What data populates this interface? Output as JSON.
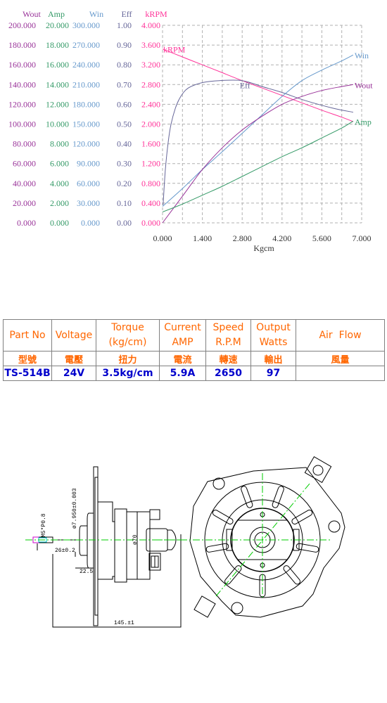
{
  "chart_data": {
    "type": "line",
    "xlabel": "Kgcm",
    "xlim": [
      0,
      7.0
    ],
    "xticks": [
      "0.000",
      "1.400",
      "2.800",
      "4.200",
      "5.600",
      "7.000"
    ],
    "grid": true,
    "gridDivisions": 10,
    "axes": [
      {
        "name": "Wout",
        "color": "#993399",
        "range": [
          0,
          200
        ],
        "ticks": [
          "0.000",
          "20.000",
          "40.000",
          "60.000",
          "80.000",
          "100.000",
          "120.000",
          "140.000",
          "160.000",
          "180.000",
          "200.000"
        ]
      },
      {
        "name": "Amp",
        "color": "#339966",
        "range": [
          0,
          20
        ],
        "ticks": [
          "0.000",
          "2.000",
          "4.000",
          "6.000",
          "8.000",
          "10.000",
          "12.000",
          "14.000",
          "16.000",
          "18.000",
          "20.000"
        ]
      },
      {
        "name": "Win",
        "color": "#6699cc",
        "range": [
          0,
          300
        ],
        "ticks": [
          "0.000",
          "30.000",
          "60.000",
          "90.000",
          "120.000",
          "150.000",
          "180.000",
          "210.000",
          "240.000",
          "270.000",
          "300.000"
        ]
      },
      {
        "name": "Eff",
        "color": "#666699",
        "range": [
          0,
          1.0
        ],
        "ticks": [
          "0.00",
          "0.10",
          "0.20",
          "0.30",
          "0.40",
          "0.50",
          "0.60",
          "0.70",
          "0.80",
          "0.90",
          "1.00"
        ]
      },
      {
        "name": "kRPM",
        "color": "#ff3399",
        "range": [
          0,
          4.0
        ],
        "ticks": [
          "0.000",
          "0.400",
          "0.800",
          "1.200",
          "1.600",
          "2.000",
          "2.400",
          "2.800",
          "3.200",
          "3.600",
          "4.000"
        ]
      }
    ],
    "series": [
      {
        "name": "kRPM",
        "label": "kRPM",
        "axis": "kRPM",
        "color": "#ff3399",
        "labelPos": "start",
        "x": [
          0,
          0.7,
          1.4,
          2.1,
          2.8,
          3.5,
          4.2,
          4.9,
          5.6,
          6.3,
          6.7
        ],
        "y": [
          3.52,
          3.36,
          3.2,
          3.04,
          2.88,
          2.73,
          2.58,
          2.43,
          2.28,
          2.14,
          2.05
        ]
      },
      {
        "name": "Eff",
        "label": "Eff",
        "axis": "Eff",
        "color": "#666699",
        "labelPos": "mid",
        "x": [
          0.02,
          0.1,
          0.2,
          0.3,
          0.45,
          0.6,
          0.8,
          1.0,
          1.4,
          2.0,
          2.8,
          3.5,
          4.2,
          5.0,
          6.0,
          6.7
        ],
        "y": [
          0.09,
          0.27,
          0.41,
          0.5,
          0.58,
          0.63,
          0.67,
          0.69,
          0.71,
          0.72,
          0.72,
          0.69,
          0.66,
          0.62,
          0.58,
          0.56
        ]
      },
      {
        "name": "Win",
        "label": "Win",
        "axis": "Win",
        "color": "#6699cc",
        "labelPos": "end",
        "x": [
          0,
          0.7,
          1.4,
          2.1,
          2.8,
          3.5,
          4.2,
          4.9,
          5.6,
          6.3,
          6.7
        ],
        "y": [
          25,
          52,
          81,
          108,
          136,
          164,
          192,
          216,
          232,
          246,
          255
        ]
      },
      {
        "name": "Wout",
        "label": "Wout",
        "axis": "Wout",
        "color": "#993399",
        "labelPos": "end",
        "x": [
          0,
          0.7,
          1.4,
          2.1,
          2.8,
          3.5,
          4.2,
          4.9,
          5.6,
          6.3,
          6.7
        ],
        "y": [
          0,
          27,
          54,
          76,
          94,
          108,
          120,
          128,
          134,
          138,
          140
        ]
      },
      {
        "name": "Amp",
        "label": "Amp",
        "axis": "Amp",
        "color": "#339966",
        "labelPos": "end",
        "x": [
          0,
          0.7,
          1.4,
          2.1,
          2.8,
          3.5,
          4.2,
          4.9,
          5.6,
          6.3,
          6.7
        ],
        "y": [
          1.1,
          1.9,
          2.8,
          3.7,
          4.7,
          5.7,
          6.7,
          7.6,
          8.6,
          9.6,
          10.3
        ]
      }
    ]
  },
  "spec_table": {
    "headers": [
      "Part No",
      "Voltage",
      "Torque\n(kg/cm)",
      "Current\nAMP",
      "Speed\nR.P.M",
      "Output\nWatts",
      "Air  Flow"
    ],
    "headers_zh": [
      "型號",
      "電壓",
      "扭力",
      "電流",
      "轉速",
      "輸出",
      "風量"
    ],
    "values": [
      "TS-514B",
      "24V",
      "3.5kg/cm",
      "5.9A",
      "2650",
      "97",
      ""
    ]
  },
  "drawing": {
    "side_view_labels": {
      "thread": "M5*P0.8",
      "shaft_dia": "ø7.950±0.003",
      "shaft_len": "26±0.2",
      "flange_offset": "22.5",
      "total_len": "145.±1",
      "body_dia": "ø70"
    }
  }
}
